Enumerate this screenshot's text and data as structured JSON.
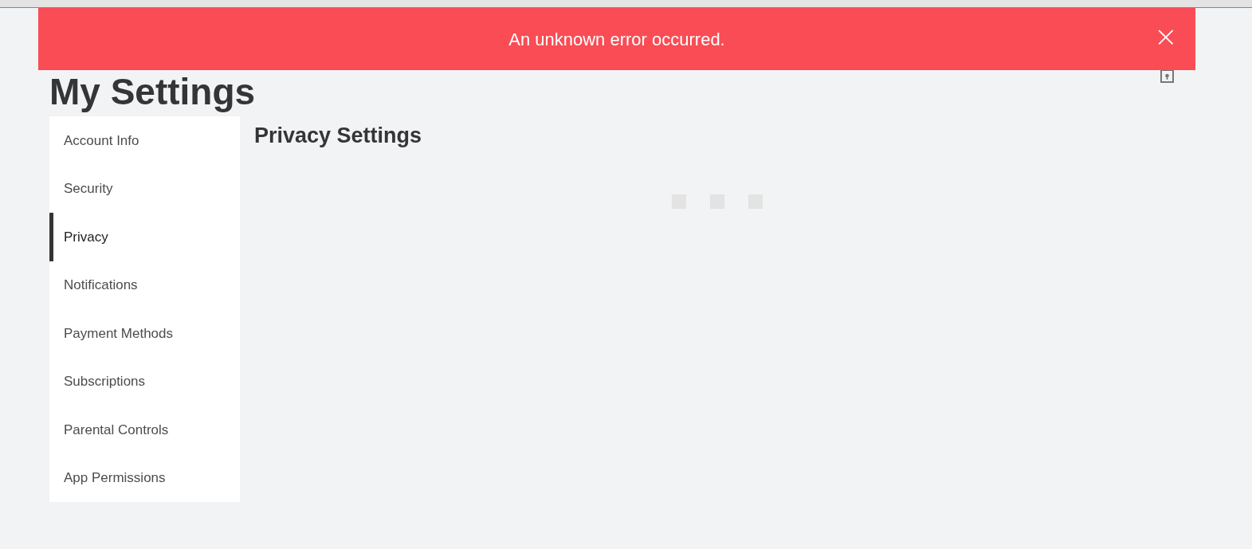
{
  "banner": {
    "message": "An unknown error occurred.",
    "close": "×"
  },
  "page": {
    "title": "My Settings"
  },
  "sidebar": {
    "items": [
      {
        "label": "Account Info",
        "selected": false
      },
      {
        "label": "Security",
        "selected": false
      },
      {
        "label": "Privacy",
        "selected": true
      },
      {
        "label": "Notifications",
        "selected": false
      },
      {
        "label": "Payment Methods",
        "selected": false
      },
      {
        "label": "Subscriptions",
        "selected": false
      },
      {
        "label": "Parental Controls",
        "selected": false
      },
      {
        "label": "App Permissions",
        "selected": false
      }
    ]
  },
  "content": {
    "title": "Privacy Settings"
  }
}
